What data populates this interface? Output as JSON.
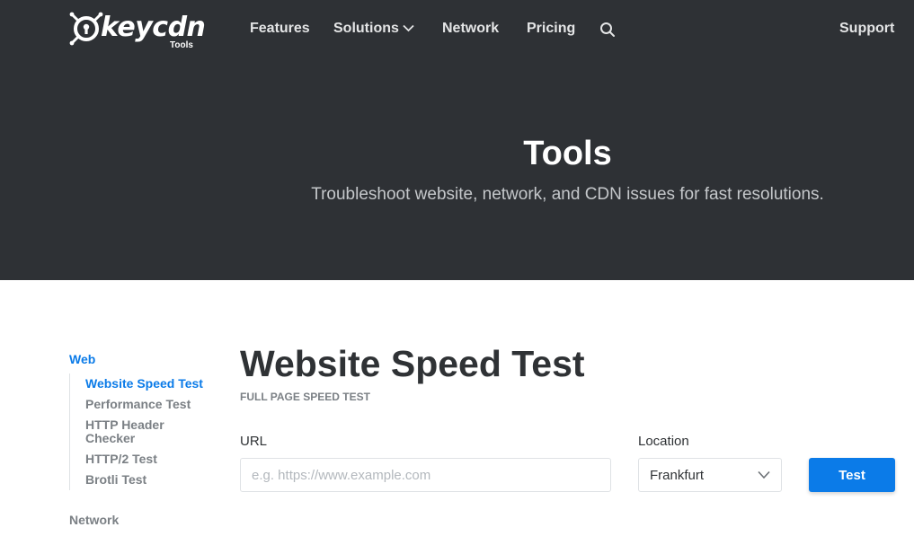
{
  "brand": {
    "name": "keycdn",
    "sub": "Tools"
  },
  "nav": {
    "items": [
      {
        "label": "Features"
      },
      {
        "label": "Solutions"
      },
      {
        "label": "Network"
      },
      {
        "label": "Pricing"
      }
    ],
    "support_label": "Support"
  },
  "hero": {
    "title": "Tools",
    "subtitle": "Troubleshoot website, network, and CDN issues for fast resolutions."
  },
  "sidebar": {
    "groups": [
      {
        "label": "Web",
        "items": [
          {
            "label": "Website Speed Test"
          },
          {
            "label": "Performance Test"
          },
          {
            "label": "HTTP Header Checker"
          },
          {
            "label": "HTTP/2 Test"
          },
          {
            "label": "Brotli Test"
          }
        ]
      },
      {
        "label": "Network"
      }
    ]
  },
  "main": {
    "title": "Website Speed Test",
    "kicker": "FULL PAGE SPEED TEST",
    "url_label": "URL",
    "url_placeholder": "e.g. https://www.example.com",
    "url_value": "",
    "location_label": "Location",
    "location_value": "Frankfurt",
    "submit_label": "Test"
  },
  "colors": {
    "hero_bg": "#2e3135",
    "accent": "#0b7be8",
    "muted": "#7b8085"
  }
}
